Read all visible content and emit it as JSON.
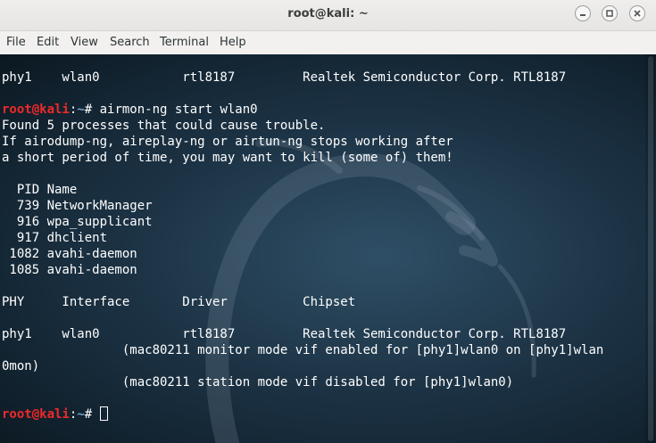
{
  "window": {
    "title": "root@kali: ~",
    "buttons": [
      "minimize-icon",
      "maximize-icon",
      "close-icon"
    ]
  },
  "menubar": {
    "items": [
      "File",
      "Edit",
      "View",
      "Search",
      "Terminal",
      "Help"
    ]
  },
  "terminal": {
    "prompt": {
      "user_host": "root@kali",
      "sep": ":",
      "path": "~",
      "symbol": "# "
    },
    "lines": [
      "phy1    wlan0           rtl8187         Realtek Semiconductor Corp. RTL8187",
      "",
      "airmon-ng start wlan0",
      "Found 5 processes that could cause trouble.",
      "If airodump-ng, aireplay-ng or airtun-ng stops working after",
      "a short period of time, you may want to kill (some of) them!",
      "",
      "  PID Name",
      "  739 NetworkManager",
      "  916 wpa_supplicant",
      "  917 dhclient",
      " 1082 avahi-daemon",
      " 1085 avahi-daemon",
      "",
      "PHY     Interface       Driver          Chipset",
      "",
      "phy1    wlan0           rtl8187         Realtek Semiconductor Corp. RTL8187",
      "                (mac80211 monitor mode vif enabled for [phy1]wlan0 on [phy1]wlan",
      "0mon)",
      "                (mac80211 station mode vif disabled for [phy1]wlan0)",
      "",
      ""
    ],
    "colors": {
      "user": "#ef2929",
      "path": "#729fcf",
      "text": "#ffffff"
    }
  }
}
